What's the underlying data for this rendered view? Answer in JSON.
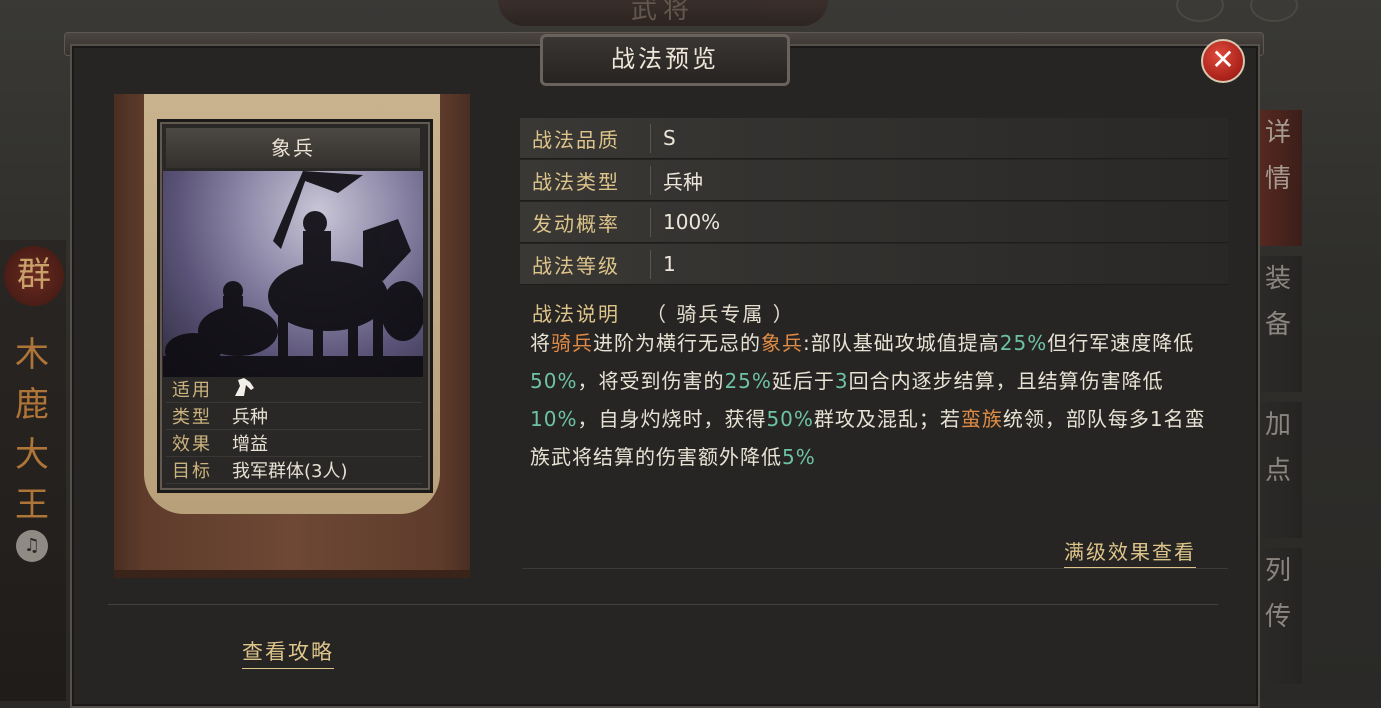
{
  "background": {
    "top_title": "武将",
    "hero_seal": "群",
    "hero_name": "木鹿大王",
    "side_tabs": [
      "详情",
      "装备",
      "加点",
      "列传"
    ]
  },
  "dialog": {
    "title": "战法预览",
    "close_icon": "close-icon"
  },
  "card": {
    "name": "象兵",
    "rows": [
      {
        "key": "适用",
        "value": "",
        "icon": "horse-icon"
      },
      {
        "key": "类型",
        "value": "兵种"
      },
      {
        "key": "效果",
        "value": "增益"
      },
      {
        "key": "目标",
        "value": "我军群体(3人)"
      }
    ]
  },
  "info": [
    {
      "key": "战法品质",
      "value": "S"
    },
    {
      "key": "战法类型",
      "value": "兵种"
    },
    {
      "key": "发动概率",
      "value": "100%"
    },
    {
      "key": "战法等级",
      "value": "1"
    }
  ],
  "description": {
    "label": "战法说明",
    "note": "（ 骑兵专属 ）",
    "segments": [
      {
        "t": "将",
        "c": "n"
      },
      {
        "t": "骑兵",
        "c": "o"
      },
      {
        "t": "进阶为横行无忌的",
        "c": "n"
      },
      {
        "t": "象兵",
        "c": "o"
      },
      {
        "t": ":部队基础攻城值提高",
        "c": "n"
      },
      {
        "t": "25%",
        "c": "g"
      },
      {
        "t": "但行军速度降低",
        "c": "n"
      },
      {
        "t": "50%",
        "c": "g"
      },
      {
        "t": "，将受到伤害的",
        "c": "n"
      },
      {
        "t": "25%",
        "c": "g"
      },
      {
        "t": "延后于",
        "c": "n"
      },
      {
        "t": "3",
        "c": "g"
      },
      {
        "t": "回合内逐步结算，且结算伤害降低",
        "c": "n"
      },
      {
        "t": "10%",
        "c": "g"
      },
      {
        "t": "，自身灼烧时，获得",
        "c": "n"
      },
      {
        "t": "50%",
        "c": "g"
      },
      {
        "t": "群攻及混乱；若",
        "c": "n"
      },
      {
        "t": "蛮族",
        "c": "o"
      },
      {
        "t": "统领，部队每多1名蛮族武将结算的伤害额外降低",
        "c": "n"
      },
      {
        "t": "5%",
        "c": "g"
      }
    ]
  },
  "links": {
    "full_effect": "满级效果查看",
    "guide": "查看攻略"
  },
  "colors": {
    "orange": "#e08b45",
    "green": "#6cc2a3",
    "gold": "#ddc48a"
  }
}
